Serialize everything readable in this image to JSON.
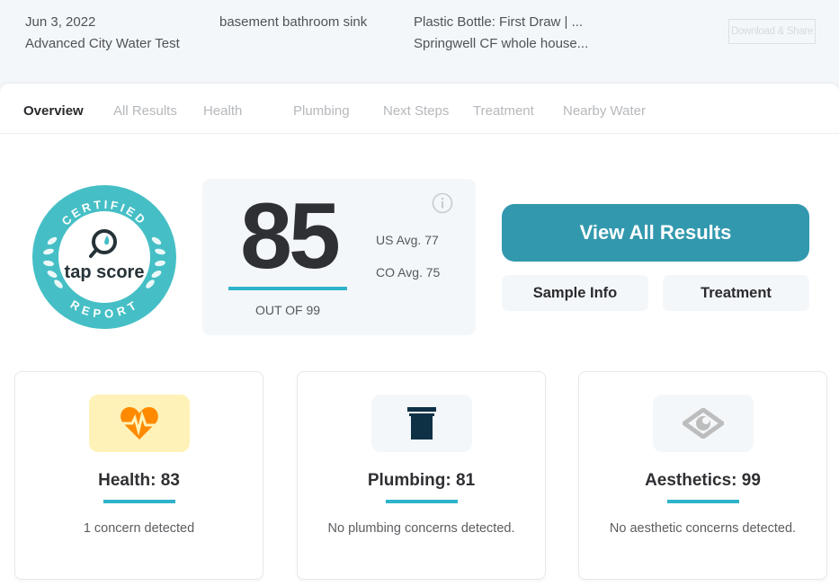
{
  "header": {
    "date": "Jun 3, 2022",
    "test_name": "Advanced City Water Test",
    "location": "basement bathroom sink",
    "sample_type": "Plastic Bottle: First Draw | ...",
    "treatment": "Springwell CF whole house...",
    "download_share_label": "Download & Share"
  },
  "tabs": [
    {
      "label": "Overview",
      "active": true
    },
    {
      "label": "All Results",
      "active": false
    },
    {
      "label": "Health",
      "active": false
    },
    {
      "label": "Plumbing",
      "active": false
    },
    {
      "label": "Next Steps",
      "active": false
    },
    {
      "label": "Treatment",
      "active": false
    },
    {
      "label": "Nearby Water",
      "active": false
    }
  ],
  "badge": {
    "top_text": "CERTIFIED",
    "brand": "tap score",
    "bottom_text": "REPORT"
  },
  "score": {
    "value": "85",
    "out_of": "OUT OF 99",
    "us_avg": "US Avg. 77",
    "co_avg": "CO Avg. 75"
  },
  "actions": {
    "view_all": "View All Results",
    "sample_info": "Sample Info",
    "treatment": "Treatment"
  },
  "categories": [
    {
      "icon": "heart-pulse-icon",
      "title": "Health: 83",
      "desc": "1 concern detected",
      "icon_bg": "#fff2b8",
      "icon_color": "#ff8a00"
    },
    {
      "icon": "pipe-icon",
      "title": "Plumbing: 81",
      "desc": "No plumbing concerns detected.",
      "icon_bg": "#f4f7fa",
      "icon_color": "#0f3146"
    },
    {
      "icon": "eye-icon",
      "title": "Aesthetics: 99",
      "desc": "No aesthetic concerns detected.",
      "icon_bg": "#f4f7fa",
      "icon_color": "#bdbdbd"
    }
  ],
  "colors": {
    "accent": "#2fb3c9",
    "primary_button": "#3298ae",
    "badge_teal": "#45bfc5"
  }
}
